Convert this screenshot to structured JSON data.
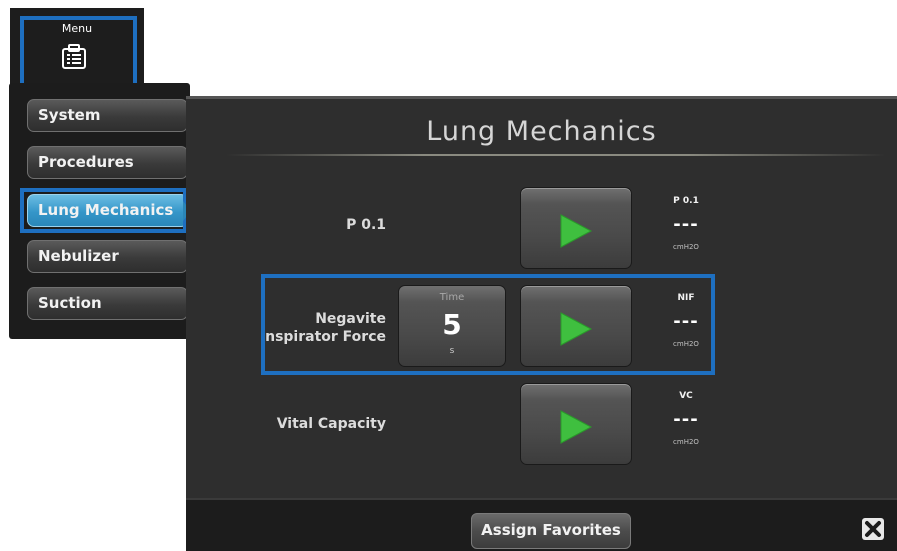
{
  "menu": {
    "label": "Menu",
    "icon": "clipboard-list-icon"
  },
  "sidebar": {
    "items": [
      {
        "label": "System",
        "active": false
      },
      {
        "label": "Procedures",
        "active": false
      },
      {
        "label": "Lung Mechanics",
        "active": true
      },
      {
        "label": "Nebulizer",
        "active": false
      },
      {
        "label": "Suction",
        "active": false
      }
    ]
  },
  "main": {
    "title": "Lung Mechanics",
    "rows": [
      {
        "label": "P 0.1",
        "readout": {
          "name": "P 0.1",
          "value": "---",
          "unit": "cmH2O"
        }
      },
      {
        "label_line1": "Negavite",
        "label_line2": "Inspirator Force",
        "time": {
          "label": "Time",
          "value": "5",
          "unit": "s"
        },
        "readout": {
          "name": "NIF",
          "value": "---",
          "unit": "cmH2O"
        }
      },
      {
        "label": "Vital Capacity",
        "readout": {
          "name": "VC",
          "value": "---",
          "unit": "cmH2O"
        }
      }
    ]
  },
  "footer": {
    "assign_label": "Assign Favorites",
    "close_icon": "close-icon"
  },
  "colors": {
    "highlight": "#1e6fc0",
    "active_item": "#3596c9",
    "play_green": "#3fbf3f"
  }
}
